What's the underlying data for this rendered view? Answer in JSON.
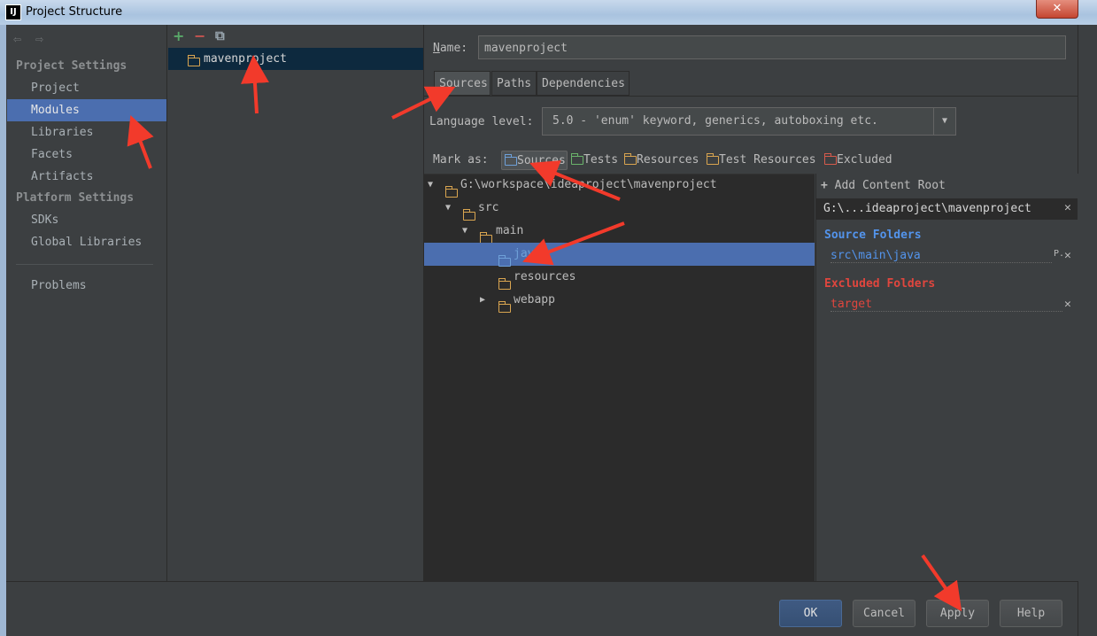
{
  "window": {
    "title": "Project Structure",
    "app_icon": "IJ",
    "close_glyph": "✕"
  },
  "nav": {
    "back_icon": "⇦",
    "forward_icon": "⇨",
    "project_settings_header": "Project Settings",
    "project_items": [
      "Project",
      "Modules",
      "Libraries",
      "Facets",
      "Artifacts"
    ],
    "platform_settings_header": "Platform Settings",
    "platform_items": [
      "SDKs",
      "Global Libraries"
    ],
    "problems": "Problems",
    "selected": "Modules"
  },
  "modules_toolbar": {
    "add": "+",
    "remove": "−",
    "copy": "⧉"
  },
  "modules": [
    "mavenproject"
  ],
  "name_label": "Name:",
  "name_value": "mavenproject",
  "tabs": [
    "Sources",
    "Paths",
    "Dependencies"
  ],
  "active_tab": "Sources",
  "language_level": {
    "label": "Language level:",
    "value": "5.0 - 'enum' keyword, generics, autoboxing etc."
  },
  "mark_as": {
    "label": "Mark as:",
    "buttons": [
      "Sources",
      "Tests",
      "Resources",
      "Test Resources",
      "Excluded"
    ]
  },
  "tree": [
    {
      "label": "G:\\workspace\\ideaproject\\mavenproject",
      "level": 0,
      "expand": "▼"
    },
    {
      "label": "src",
      "level": 1,
      "expand": "▼"
    },
    {
      "label": "main",
      "level": 2,
      "expand": "▼"
    },
    {
      "label": "java",
      "level": 3,
      "expand": "",
      "selected": true
    },
    {
      "label": "resources",
      "level": 3,
      "expand": ""
    },
    {
      "label": "webapp",
      "level": 3,
      "expand": "▶"
    }
  ],
  "content_root": {
    "add_label": "Add Content Root",
    "root_path": "G:\\...ideaproject\\mavenproject",
    "source_folders_header": "Source Folders",
    "source_folders": [
      "src\\main\\java"
    ],
    "excluded_folders_header": "Excluded Folders",
    "excluded_folders": [
      "target"
    ],
    "source_color": "#5394ec",
    "excluded_color": "#e0463e"
  },
  "buttons": {
    "ok": "OK",
    "cancel": "Cancel",
    "apply": "Apply",
    "help": "Help"
  },
  "accent": "#4b6eaf"
}
